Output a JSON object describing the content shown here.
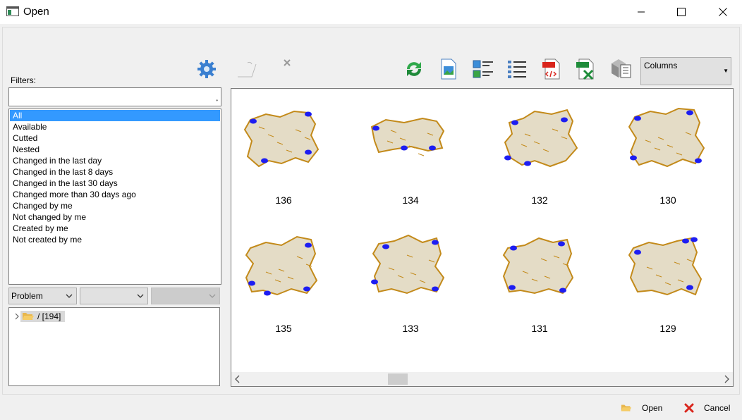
{
  "window": {
    "title": "Open"
  },
  "toolbar": {
    "view_mode": "Columns",
    "icons": [
      "gear-icon",
      "undo-icon",
      "clear-icon",
      "refresh-icon",
      "image-view-icon",
      "list-thumbnails-icon",
      "details-list-icon",
      "xml-export-icon",
      "csv-export-icon",
      "3d-view-icon"
    ]
  },
  "filters": {
    "label": "Filters:",
    "search_value": "",
    "items": [
      "All",
      "Available",
      "Cutted",
      "Nested",
      "Changed in the last day",
      "Changed in the last 8 days",
      "Changed in the last 30 days",
      "Changed more than 30 days ago",
      "Changed by me",
      "Not changed by me",
      "Created by me",
      "Not created by me"
    ],
    "selected": "All"
  },
  "group_combos": [
    {
      "value": "Problem"
    },
    {
      "value": ""
    },
    {
      "value": ""
    }
  ],
  "tree": {
    "root_label": "/ [194]"
  },
  "items": [
    {
      "id": "136"
    },
    {
      "id": "134"
    },
    {
      "id": "132"
    },
    {
      "id": "130"
    },
    {
      "id": "135"
    },
    {
      "id": "133"
    },
    {
      "id": "131"
    },
    {
      "id": "129"
    }
  ],
  "footer": {
    "open_label": "Open",
    "cancel_label": "Cancel"
  },
  "colors": {
    "selection": "#3399ff",
    "hide_fill": "#e4dcc6",
    "hide_outline": "#c38a1a",
    "defect": "#1d1df2"
  }
}
